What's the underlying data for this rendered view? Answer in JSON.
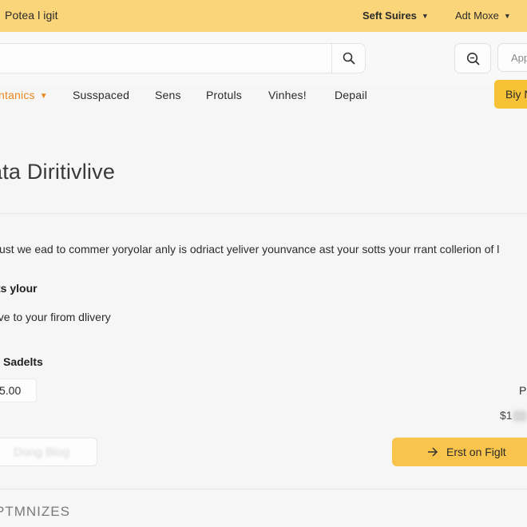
{
  "topbar": {
    "logo": "Potea l igit",
    "menu_1": "Seft Suires",
    "menu_2": "Adt Moxe"
  },
  "search": {
    "placeholder": "",
    "zoom_icon": "zoom-icon",
    "search_icon": "search-icon",
    "app_label": "App"
  },
  "nav": {
    "items": [
      {
        "label": "ntanics",
        "active": true
      },
      {
        "label": "Susspaced"
      },
      {
        "label": "Sens"
      },
      {
        "label": "Protuls"
      },
      {
        "label": "Vinhes!"
      },
      {
        "label": "Depail"
      }
    ],
    "buy_label": "Biy N"
  },
  "main": {
    "title": "ata Diritivlive",
    "body": "sust we ead to commer yoryolar anly is odriact yeliver younvance ast your sotts your rrant collerion of l",
    "section_1_heading": "ts ylour",
    "section_1_text": "eve to your firom dlivery",
    "section_2_heading": "Sadelts",
    "price_value": "5.00",
    "right_label": "P",
    "right_price": "$1",
    "ghost_button": "Dong Blog",
    "primary_button": "Erst on Figlt",
    "footer_heading": "PTMNIZES"
  },
  "colors": {
    "topbar": "#fbd579",
    "accent": "#e9891f",
    "primary_button": "#f9c44c",
    "buy_button": "#f7c235"
  }
}
